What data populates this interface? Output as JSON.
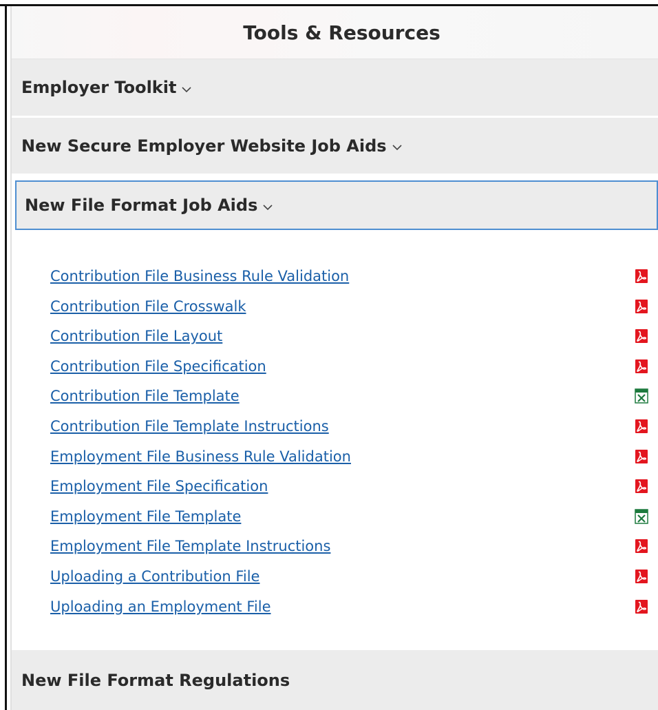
{
  "panel": {
    "title": "Tools & Resources"
  },
  "sections": [
    {
      "label": "Employer Toolkit",
      "expanded": false
    },
    {
      "label": "New Secure Employer Website Job Aids",
      "expanded": false
    },
    {
      "label": "New File Format Job Aids",
      "expanded": true
    },
    {
      "label": "New File Format Regulations",
      "expanded": false
    }
  ],
  "chevron_icon": "chevron-down-icon",
  "links": [
    {
      "label": "Contribution File Business Rule Validation",
      "icon": "pdf-icon"
    },
    {
      "label": "Contribution File Crosswalk",
      "icon": "pdf-icon"
    },
    {
      "label": "Contribution File Layout",
      "icon": "pdf-icon"
    },
    {
      "label": "Contribution File Specification",
      "icon": "pdf-icon"
    },
    {
      "label": "Contribution File Template",
      "icon": "excel-icon"
    },
    {
      "label": "Contribution File Template Instructions",
      "icon": "pdf-icon"
    },
    {
      "label": "Employment File Business Rule Validation",
      "icon": "pdf-icon"
    },
    {
      "label": "Employment File Specification",
      "icon": "pdf-icon"
    },
    {
      "label": "Employment File Template",
      "icon": "excel-icon"
    },
    {
      "label": "Employment File Template Instructions",
      "icon": "pdf-icon"
    },
    {
      "label": "Uploading a Contribution File",
      "icon": "pdf-icon"
    },
    {
      "label": "Uploading an Employment File",
      "icon": "pdf-icon"
    }
  ],
  "colors": {
    "link": "#1a5fa8",
    "pdf": "#e3161f",
    "excel": "#1d7a3e",
    "active_border": "#4e8ed1"
  }
}
